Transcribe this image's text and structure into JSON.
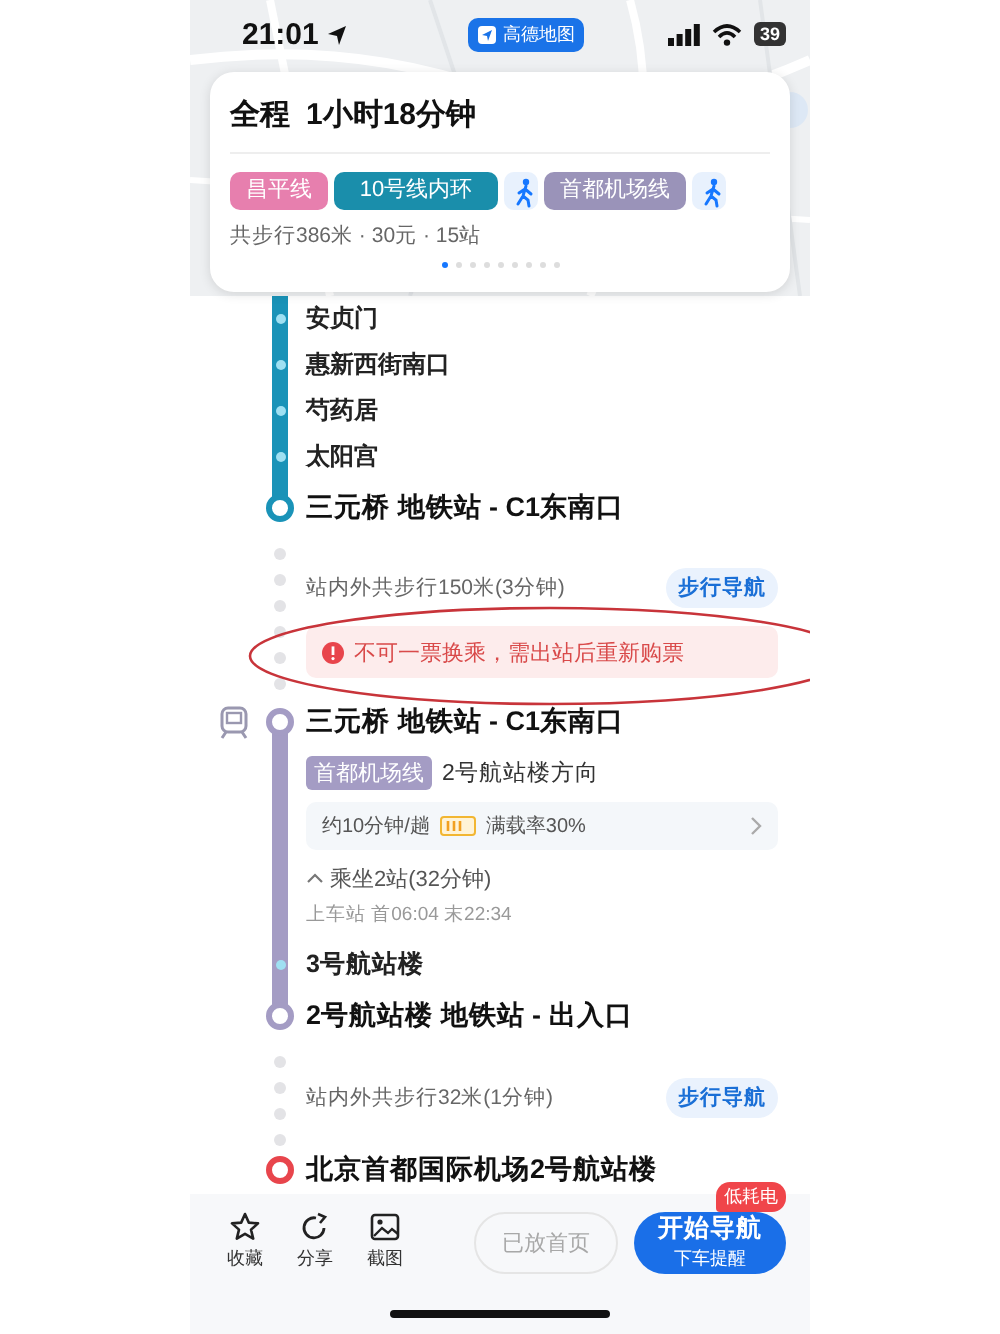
{
  "status_bar": {
    "time": "21:01",
    "app_badge": "高德地图",
    "battery": "39"
  },
  "summary": {
    "title": "全程",
    "duration": "1小时18分钟",
    "legs": [
      {
        "kind": "line",
        "label": "昌平线",
        "color": "#e77fae"
      },
      {
        "kind": "line",
        "label": "10号线内环",
        "color": "#1a8eab"
      },
      {
        "kind": "walk"
      },
      {
        "kind": "line",
        "label": "首都机场线",
        "color": "#9a93b9"
      },
      {
        "kind": "walk"
      }
    ],
    "stats": "共步行386米 · 30元 · 15站",
    "pages": [
      {
        "selected": true
      },
      {
        "selected": false
      },
      {
        "selected": false
      },
      {
        "selected": false
      },
      {
        "selected": false
      },
      {
        "selected": false
      },
      {
        "selected": false
      },
      {
        "selected": false
      },
      {
        "selected": false
      }
    ]
  },
  "route": [
    {
      "kind": "transit",
      "color": "#1a93b8",
      "stops": [
        "安贞门",
        "惠新西街南口",
        "芍药居",
        "太阳宫"
      ],
      "end": "三元桥 地铁站 - C1东南口"
    },
    {
      "kind": "walk",
      "text": "站内外共步行150米(3分钟)",
      "button": "步行导航",
      "alert": "不可一票换乘，需出站后重新购票"
    },
    {
      "kind": "transit",
      "color": "#a49cc4",
      "start": "三元桥 地铁站 - C1东南口",
      "line_tag": "首都机场线",
      "direction": "2号航站楼方向",
      "frequency": "约10分钟/趟",
      "crowding": "满载率30%",
      "ride": "乘坐2站(32分钟)",
      "expanded": true,
      "times": "上车站 首06:04 末22:34",
      "stops": [
        "3号航站楼"
      ],
      "end": "2号航站楼 地铁站 - 出入口"
    },
    {
      "kind": "walk",
      "text": "站内外共步行32米(1分钟)",
      "button": "步行导航"
    },
    {
      "kind": "destination",
      "name": "北京首都国际机场2号航站楼"
    }
  ],
  "bottom_bar": {
    "actions": [
      "收藏",
      "分享",
      "截图"
    ],
    "secondary": {
      "label": "已放首页",
      "disabled": true
    },
    "primary": {
      "label": "开始导航",
      "sublabel": "下车提醒",
      "badge": "低耗电"
    }
  }
}
